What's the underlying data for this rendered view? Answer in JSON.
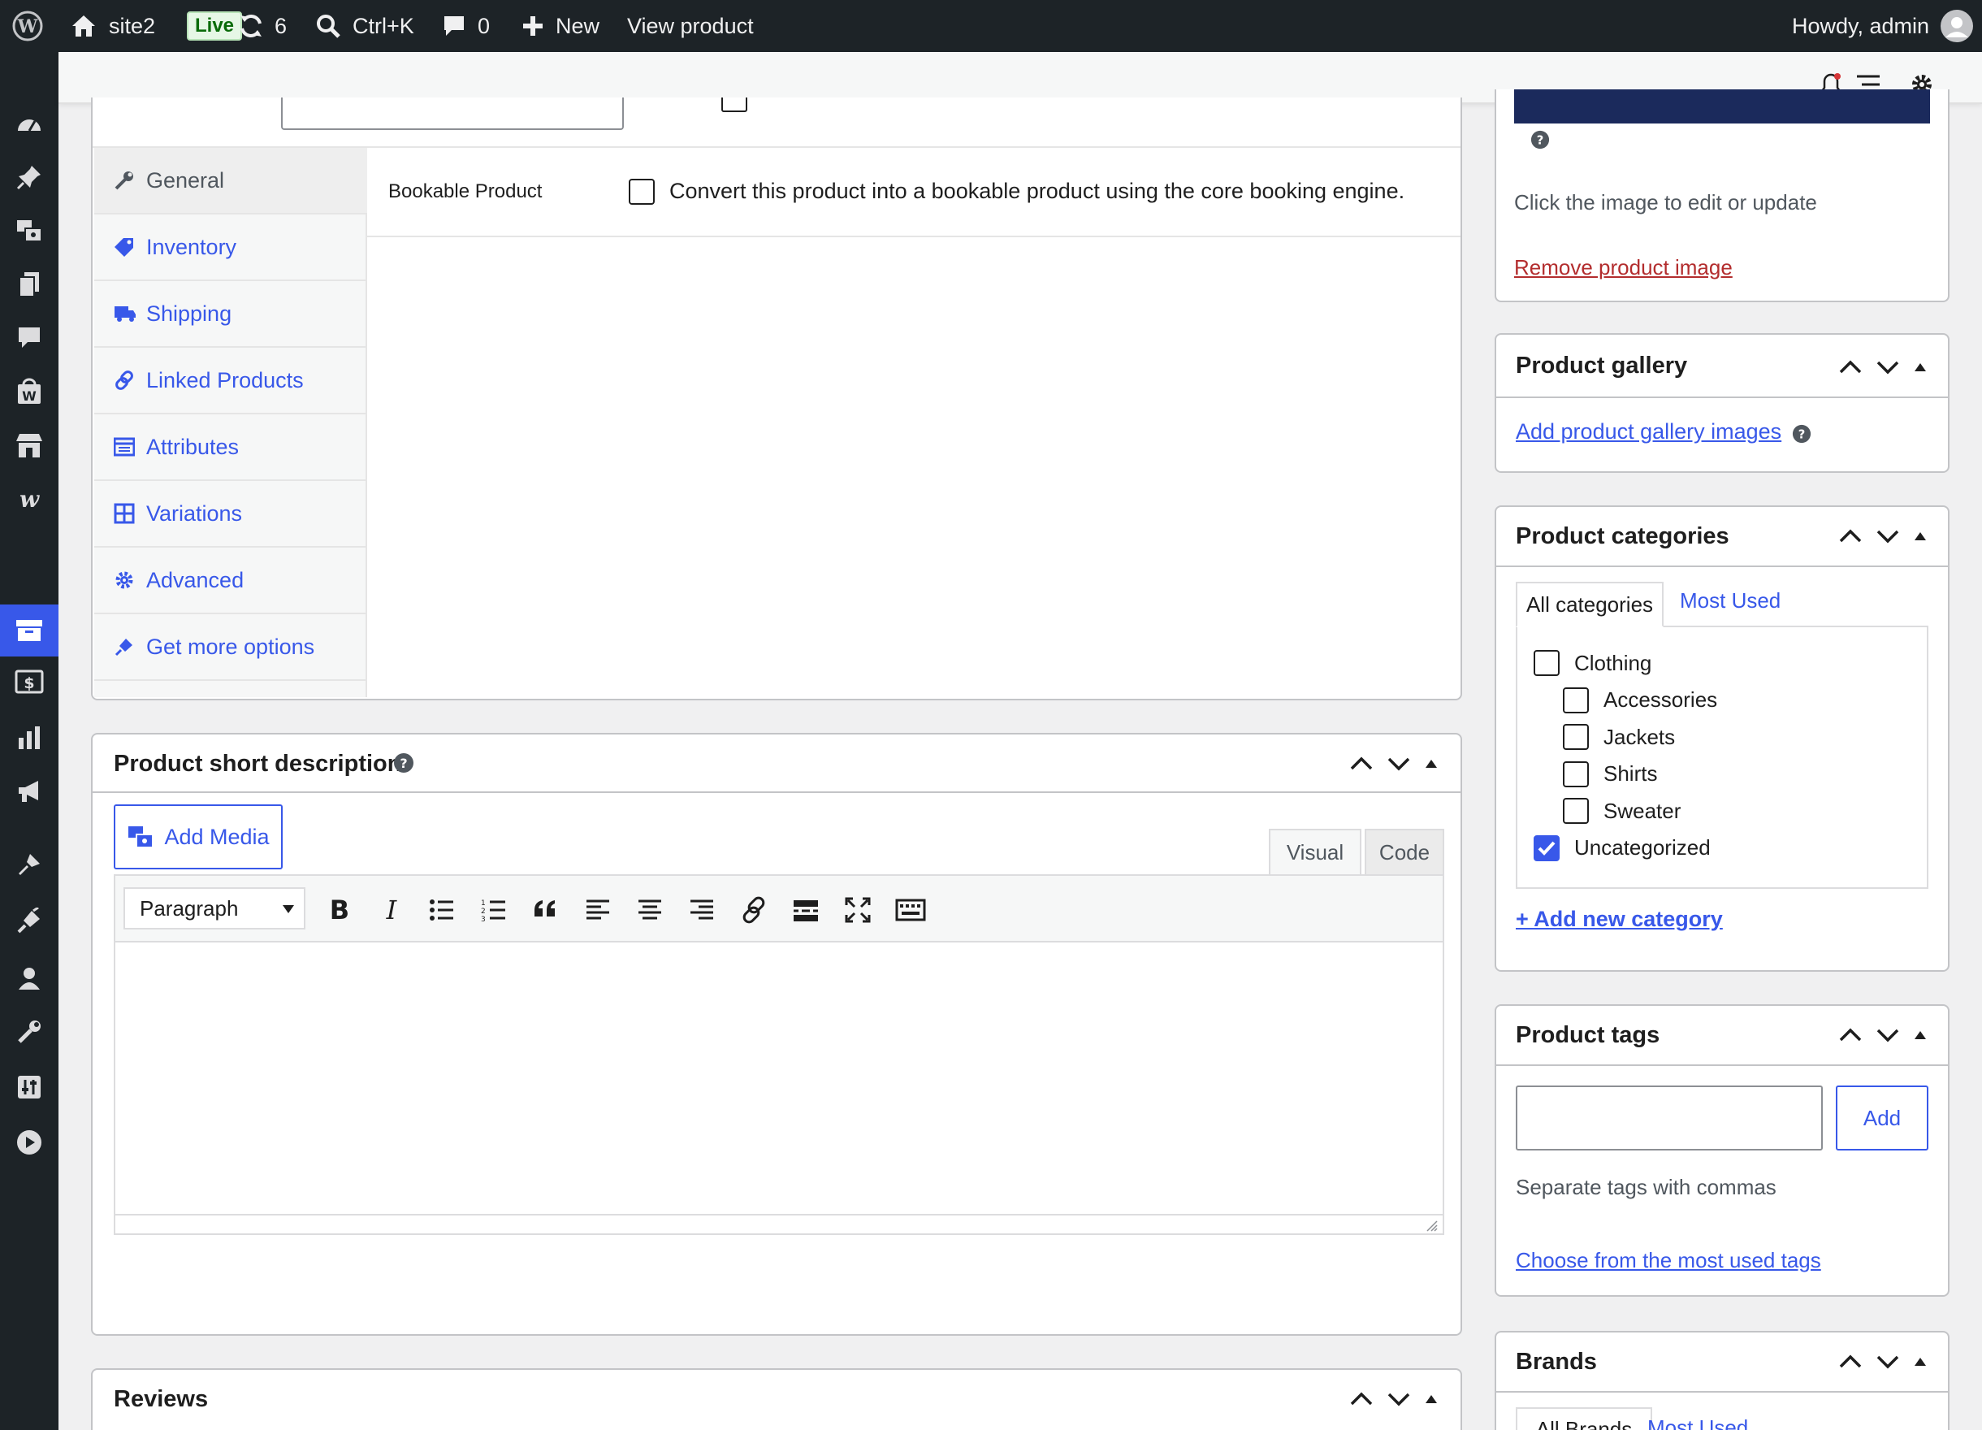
{
  "adminbar": {
    "site_name": "site2",
    "live_badge": "Live",
    "updates_count": "6",
    "search_shortcut": "Ctrl+K",
    "comments_count": "0",
    "new_label": "New",
    "view_product": "View product",
    "howdy": "Howdy, admin"
  },
  "product_data": {
    "bookable_label": "Bookable Product",
    "bookable_desc": "Convert this product into a bookable product using the core booking engine.",
    "tabs": [
      {
        "label": "General"
      },
      {
        "label": "Inventory"
      },
      {
        "label": "Shipping"
      },
      {
        "label": "Linked Products"
      },
      {
        "label": "Attributes"
      },
      {
        "label": "Variations"
      },
      {
        "label": "Advanced"
      },
      {
        "label": "Get more options"
      }
    ]
  },
  "short_description": {
    "title": "Product short description",
    "add_media": "Add Media",
    "tab_visual": "Visual",
    "tab_code": "Code",
    "format_select": "Paragraph"
  },
  "reviews": {
    "title": "Reviews"
  },
  "product_image": {
    "hint": "Click the image to edit or update",
    "remove": "Remove product image",
    "image_color": "#1b2a5c"
  },
  "product_gallery": {
    "title": "Product gallery",
    "add_link": "Add product gallery images"
  },
  "product_categories": {
    "title": "Product categories",
    "tab_all": "All categories",
    "tab_most_used": "Most Used",
    "items": [
      {
        "label": "Clothing",
        "checked": false
      },
      {
        "label": "Accessories",
        "checked": false
      },
      {
        "label": "Jackets",
        "checked": false
      },
      {
        "label": "Shirts",
        "checked": false
      },
      {
        "label": "Sweater",
        "checked": false
      },
      {
        "label": "Uncategorized",
        "checked": true
      }
    ],
    "add_new": "+ Add new category"
  },
  "product_tags": {
    "title": "Product tags",
    "add_button": "Add",
    "input_value": "",
    "hint": "Separate tags with commas",
    "choose_link": "Choose from the most used tags"
  },
  "brands": {
    "title": "Brands",
    "tab_all": "All Brands",
    "tab_most_used": "Most Used"
  },
  "colors": {
    "accent": "#3858e9",
    "admin_dark": "#1d2327",
    "danger": "#b32d2e"
  }
}
